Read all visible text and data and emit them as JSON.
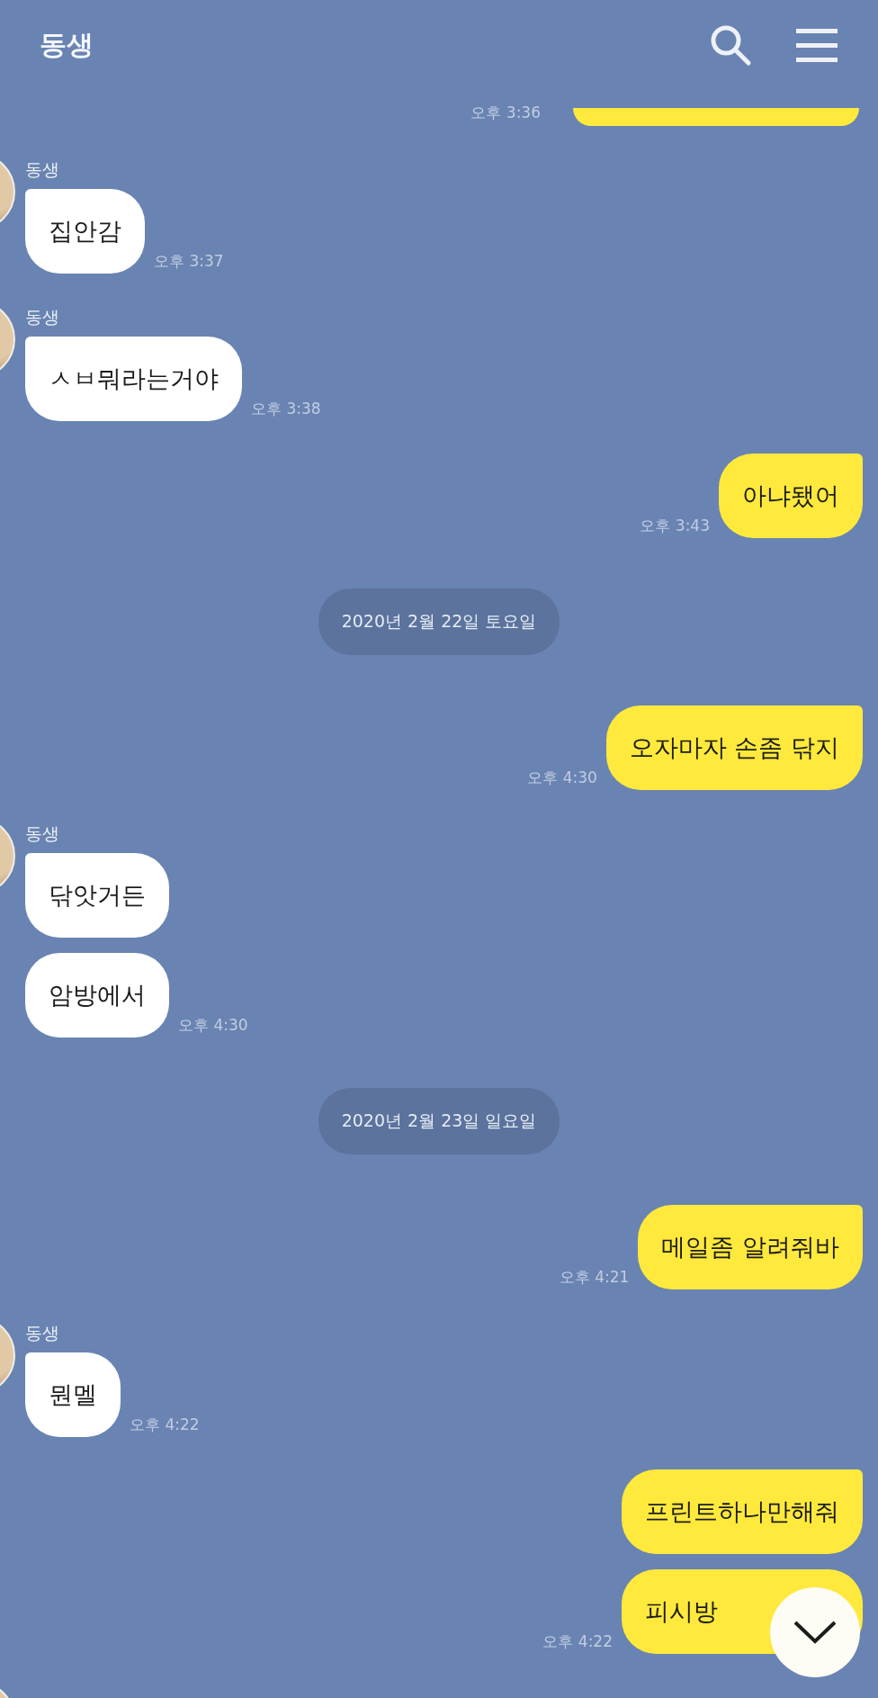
{
  "header": {
    "title": "동생"
  },
  "messages": [
    {
      "kind": "cut_sent",
      "time": "오후 3:36"
    },
    {
      "kind": "received",
      "name": "동생",
      "bubbles": [
        "집안감"
      ],
      "time": "오후 3:37"
    },
    {
      "kind": "received",
      "name": "동생",
      "bubbles": [
        "ㅅㅂ뭐라는거야"
      ],
      "time": "오후 3:38"
    },
    {
      "kind": "sent",
      "bubbles": [
        "아냐됐어"
      ],
      "time": "오후 3:43"
    },
    {
      "kind": "date",
      "text": "2020년 2월 22일 토요일"
    },
    {
      "kind": "sent",
      "bubbles": [
        "오자마자 손좀 닦지"
      ],
      "time": "오후 4:30"
    },
    {
      "kind": "received",
      "name": "동생",
      "bubbles": [
        "닦앗거든",
        "암방에서"
      ],
      "time": "오후 4:30"
    },
    {
      "kind": "date",
      "text": "2020년 2월 23일 일요일"
    },
    {
      "kind": "sent",
      "bubbles": [
        "메일좀 알려줘바"
      ],
      "time": "오후 4:21"
    },
    {
      "kind": "received",
      "name": "동생",
      "bubbles": [
        "뭔멜"
      ],
      "time": "오후 4:22"
    },
    {
      "kind": "sent",
      "bubbles": [
        "프린트하나만해줘",
        "피시방"
      ],
      "time": "오후 4:22"
    },
    {
      "kind": "cut_received"
    }
  ]
}
